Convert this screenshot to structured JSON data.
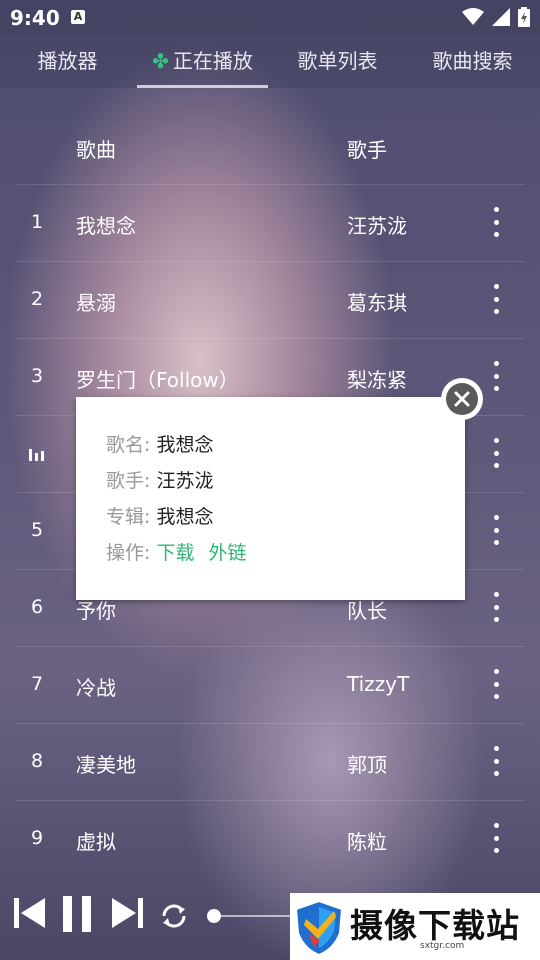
{
  "status": {
    "time": "9:40",
    "a_badge": "A"
  },
  "tabs": [
    {
      "label": "播放器"
    },
    {
      "label": "正在播放",
      "active": true
    },
    {
      "label": "歌单列表"
    },
    {
      "label": "歌曲搜索"
    }
  ],
  "list": {
    "header_song": "歌曲",
    "header_singer": "歌手",
    "rows": [
      {
        "num": "1",
        "song": "我想念",
        "singer": "汪苏泷"
      },
      {
        "num": "2",
        "song": "悬溺",
        "singer": "葛东琪"
      },
      {
        "num": "3",
        "song": "罗生门（Follow）",
        "singer": "梨冻紧"
      },
      {
        "num": "",
        "song": "",
        "singer": "",
        "playing": true
      },
      {
        "num": "5",
        "song": "",
        "singer": ""
      },
      {
        "num": "6",
        "song": "予你",
        "singer": "队长"
      },
      {
        "num": "7",
        "song": "冷战",
        "singer": "TizzyT"
      },
      {
        "num": "8",
        "song": "凄美地",
        "singer": "郭顶"
      },
      {
        "num": "9",
        "song": "虚拟",
        "singer": "陈粒"
      }
    ]
  },
  "popup": {
    "name_label": "歌名:",
    "name_value": "我想念",
    "singer_label": "歌手:",
    "singer_value": "汪苏泷",
    "album_label": "专辑:",
    "album_value": "我想念",
    "ops_label": "操作:",
    "download": "下载",
    "external_link": "外链"
  },
  "watermark": {
    "title": "摄像下载站",
    "url": "sxtgr.com"
  },
  "colors": {
    "accent": "#2fb674"
  }
}
